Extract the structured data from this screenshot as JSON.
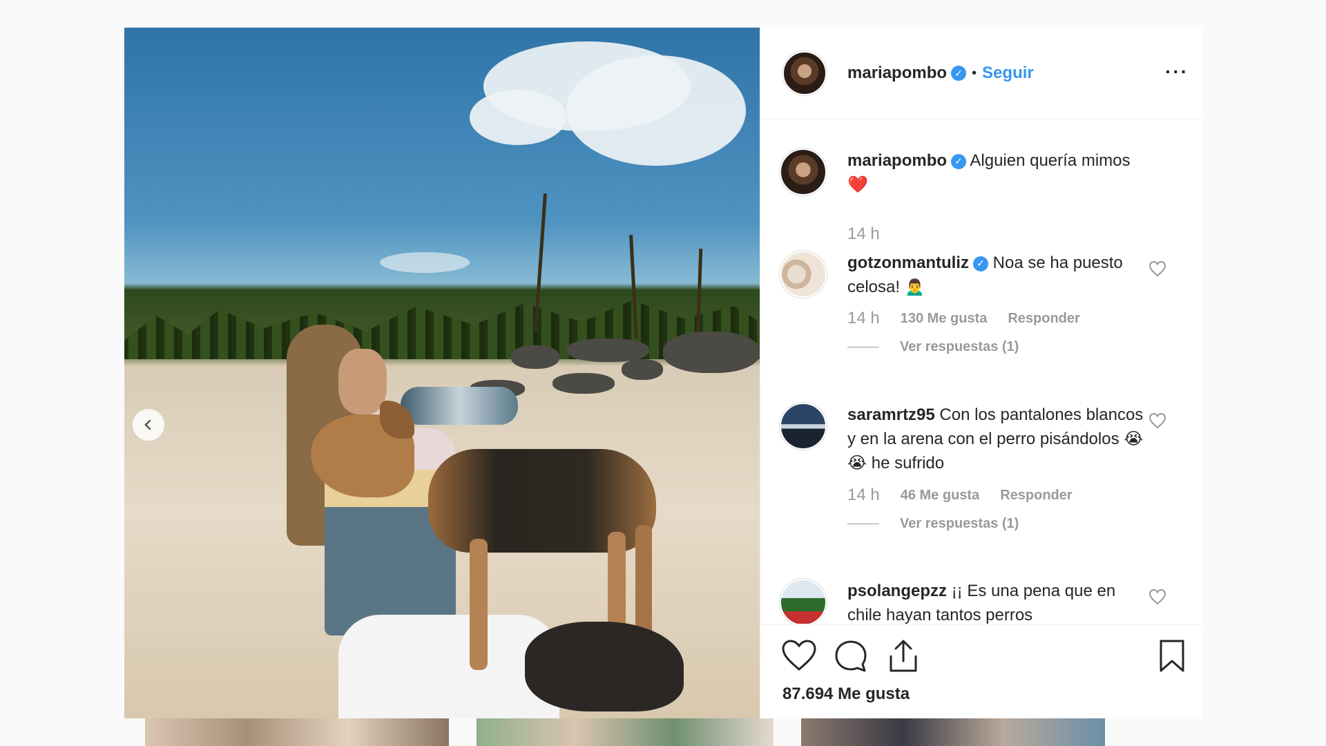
{
  "post": {
    "username": "mariapombo",
    "separator": "•",
    "follow_label": "Seguir",
    "more_label": "···",
    "verified_glyph": "✓",
    "caption": {
      "username": "mariapombo",
      "text": "Alguien quería mimos",
      "emoji": "❤️",
      "time": "14 h"
    },
    "comments": [
      {
        "username": "gotzonmantuliz",
        "verified": true,
        "text": "Noa se ha puesto celosa!",
        "emoji": "🙍‍♂️",
        "time": "14 h",
        "likes": "130 Me gusta",
        "reply_label": "Responder",
        "view_replies": "Ver respuestas (1)"
      },
      {
        "username": "saramrtz95",
        "verified": false,
        "text": "Con los pantalones blancos y en la arena con el perro pisándolos",
        "emoji": "😭😭",
        "text_after": "he sufrido",
        "time": "14 h",
        "likes": "46 Me gusta",
        "reply_label": "Responder",
        "view_replies": "Ver respuestas (1)"
      },
      {
        "username": "psolangepzz",
        "verified": false,
        "text": "¡¡ Es una pena que en chile hayan tantos perros"
      }
    ],
    "likes_count": "87.694 Me gusta"
  },
  "icons": {
    "prev": "chevron-left-icon",
    "like": "heart-icon",
    "comment": "comment-icon",
    "share": "share-icon",
    "save": "bookmark-icon"
  },
  "colors": {
    "accent": "#3897f0",
    "text": "#262626",
    "muted": "#999999",
    "border": "#efefef"
  }
}
